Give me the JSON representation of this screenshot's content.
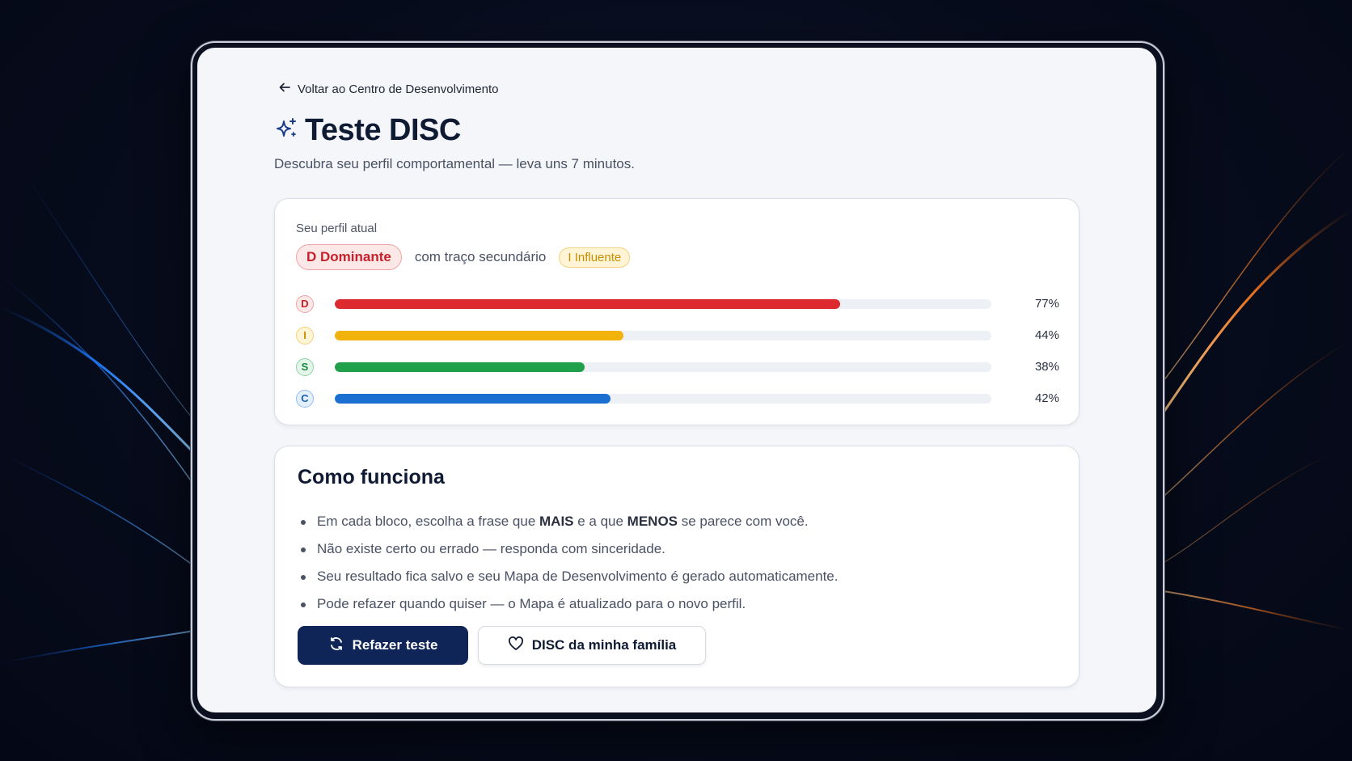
{
  "nav": {
    "back_label": "Voltar ao Centro de Desenvolvimento"
  },
  "header": {
    "title": "Teste DISC",
    "subtitle": "Descubra seu perfil comportamental — leva uns 7 minutos."
  },
  "profile": {
    "label": "Seu perfil atual",
    "primary_badge": "D Dominante",
    "secondary_text": "com traço secundário",
    "secondary_badge": "I Influente",
    "bars": [
      {
        "letter": "D",
        "value": 77,
        "label": "77%",
        "color": "#dc2a2f",
        "circle_bg": "#fde8e8",
        "circle_border": "#f0a3a6",
        "circle_text": "#c8202a"
      },
      {
        "letter": "I",
        "value": 44,
        "label": "44%",
        "color": "#f2b20c",
        "circle_bg": "#fff5d6",
        "circle_border": "#f2d27a",
        "circle_text": "#c98e00"
      },
      {
        "letter": "S",
        "value": 38,
        "label": "38%",
        "color": "#20a04a",
        "circle_bg": "#e3f6e9",
        "circle_border": "#8fd3a5",
        "circle_text": "#1d8a40"
      },
      {
        "letter": "C",
        "value": 42,
        "label": "42%",
        "color": "#1a6fd0",
        "circle_bg": "#e4effc",
        "circle_border": "#93bdee",
        "circle_text": "#1a5fb4"
      }
    ]
  },
  "how": {
    "title": "Como funciona",
    "items": [
      {
        "pre": "Em cada bloco, escolha a frase que ",
        "b1": "MAIS",
        "mid": " e a que ",
        "b2": "MENOS",
        "post": " se parece com você."
      },
      {
        "pre": "Não existe certo ou errado — responda com sinceridade."
      },
      {
        "pre": "Seu resultado fica salvo e seu Mapa de Desenvolvimento é gerado automaticamente."
      },
      {
        "pre": "Pode refazer quando quiser — o Mapa é atualizado para o novo perfil."
      }
    ],
    "retake_label": "Refazer teste",
    "family_label": "DISC da minha família"
  },
  "icons": {
    "back": "arrow-left-icon",
    "title": "sparkles-icon",
    "retake": "refresh-icon",
    "family": "heart-icon"
  }
}
